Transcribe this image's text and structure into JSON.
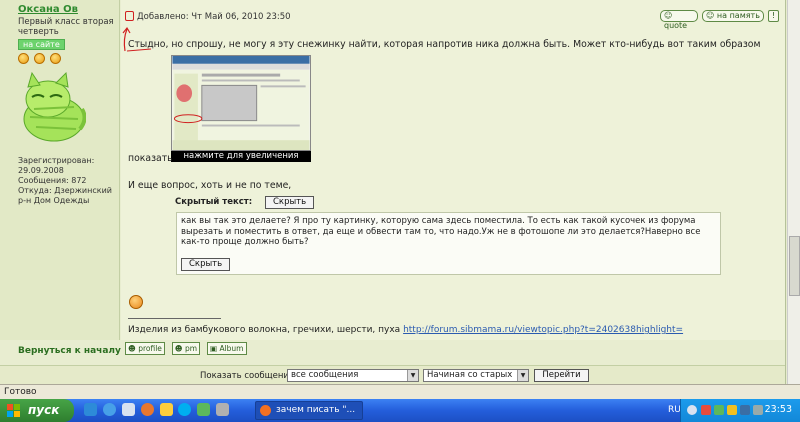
{
  "user": {
    "name": "Оксана Ов",
    "rank": "Первый класс вторая четверть",
    "online": "на сайте",
    "registered": "Зарегистрирован: 29.09.2008",
    "posts": "Сообщения: 872",
    "from": "Откуда: Дзержинский р-н Дом Одежды"
  },
  "post": {
    "added": "Добавлено: Чт Май 06, 2010 23:50",
    "quote_label": "quote",
    "remember_label": "на память",
    "info_label": "!",
    "text1": "Стыдно, но спрошу, не могу я эту снежинку найти, которая напротив ника должна быть. Может кто-нибудь вот таким образом",
    "show_label": "показать",
    "thumb_caption": "нажмите для увеличения",
    "text2": "И еще вопрос, хоть и не по теме,",
    "spoiler_label": "Скрытый текст:",
    "hide_label": "Скрыть",
    "spoiler_text": "как вы так это делаете? Я про ту картинку, которую сама здесь поместила. То есть как такой кусочек из форума вырезать и поместить в ответ, да еще и обвести там то, что надо.Уж не в фотошопе ли это делается?Наверно все как-то проще должно быть?",
    "signature_text": "Изделия из бамбукового волокна, гречихи, шерсти, пуха",
    "signature_link": "http://forum.sibmama.ru/viewtopic.php?t=2402638highlight="
  },
  "footer": {
    "back_link": "Вернуться к началу",
    "profile_label": "profile",
    "pm_label": "pm",
    "album_label": "Album"
  },
  "bottom_bar": {
    "show_label": "Показать сообщения:",
    "msgs_value": "все сообщения",
    "order_value": "Начиная со старых",
    "go_label": "Перейти"
  },
  "status": {
    "text": "Готово"
  },
  "taskbar": {
    "start_label": "пуск",
    "task_label": "зачем писать \"...",
    "lang": "RU",
    "clock": "23:53"
  }
}
